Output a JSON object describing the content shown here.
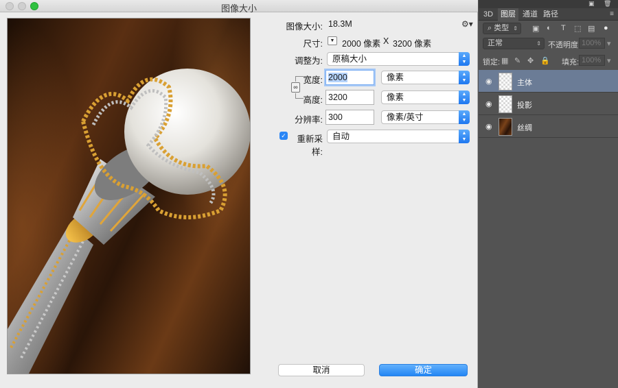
{
  "dialog": {
    "title": "图像大小",
    "image_size_label": "图像大小:",
    "image_size_value": "18.3M",
    "dimensions_label": "尺寸:",
    "dimensions_width": "2000 像素",
    "dimensions_x": "X",
    "dimensions_height": "3200 像素",
    "fit_to_label": "调整为:",
    "fit_to_value": "原稿大小",
    "width_label": "宽度:",
    "width_value": "2000",
    "width_unit": "像素",
    "height_label": "高度:",
    "height_value": "3200",
    "height_unit": "像素",
    "resolution_label": "分辨率:",
    "resolution_value": "300",
    "resolution_unit": "像素/英寸",
    "resample_label": "重新采样:",
    "resample_checked": true,
    "resample_value": "自动",
    "cancel_label": "取消",
    "ok_label": "确定"
  },
  "panel": {
    "tabs": [
      {
        "label": "3D",
        "active": false
      },
      {
        "label": "图层",
        "active": true
      },
      {
        "label": "通道",
        "active": false
      },
      {
        "label": "路径",
        "active": false
      }
    ],
    "filter_label": "类型",
    "blend_mode": "正常",
    "opacity_label": "不透明度:",
    "opacity_value": "100%",
    "lock_label": "锁定:",
    "fill_label": "填充:",
    "fill_value": "100%",
    "layers": [
      {
        "name": "主体",
        "selected": true,
        "thumb": "transparent"
      },
      {
        "name": "投影",
        "selected": false,
        "thumb": "transparent"
      },
      {
        "name": "丝绸",
        "selected": false,
        "thumb": "silk"
      }
    ]
  },
  "colors": {
    "accent_blue": "#2386f4",
    "selected_layer": "#6b7c96",
    "panel_bg": "#535353",
    "dialog_bg": "#ececec"
  }
}
